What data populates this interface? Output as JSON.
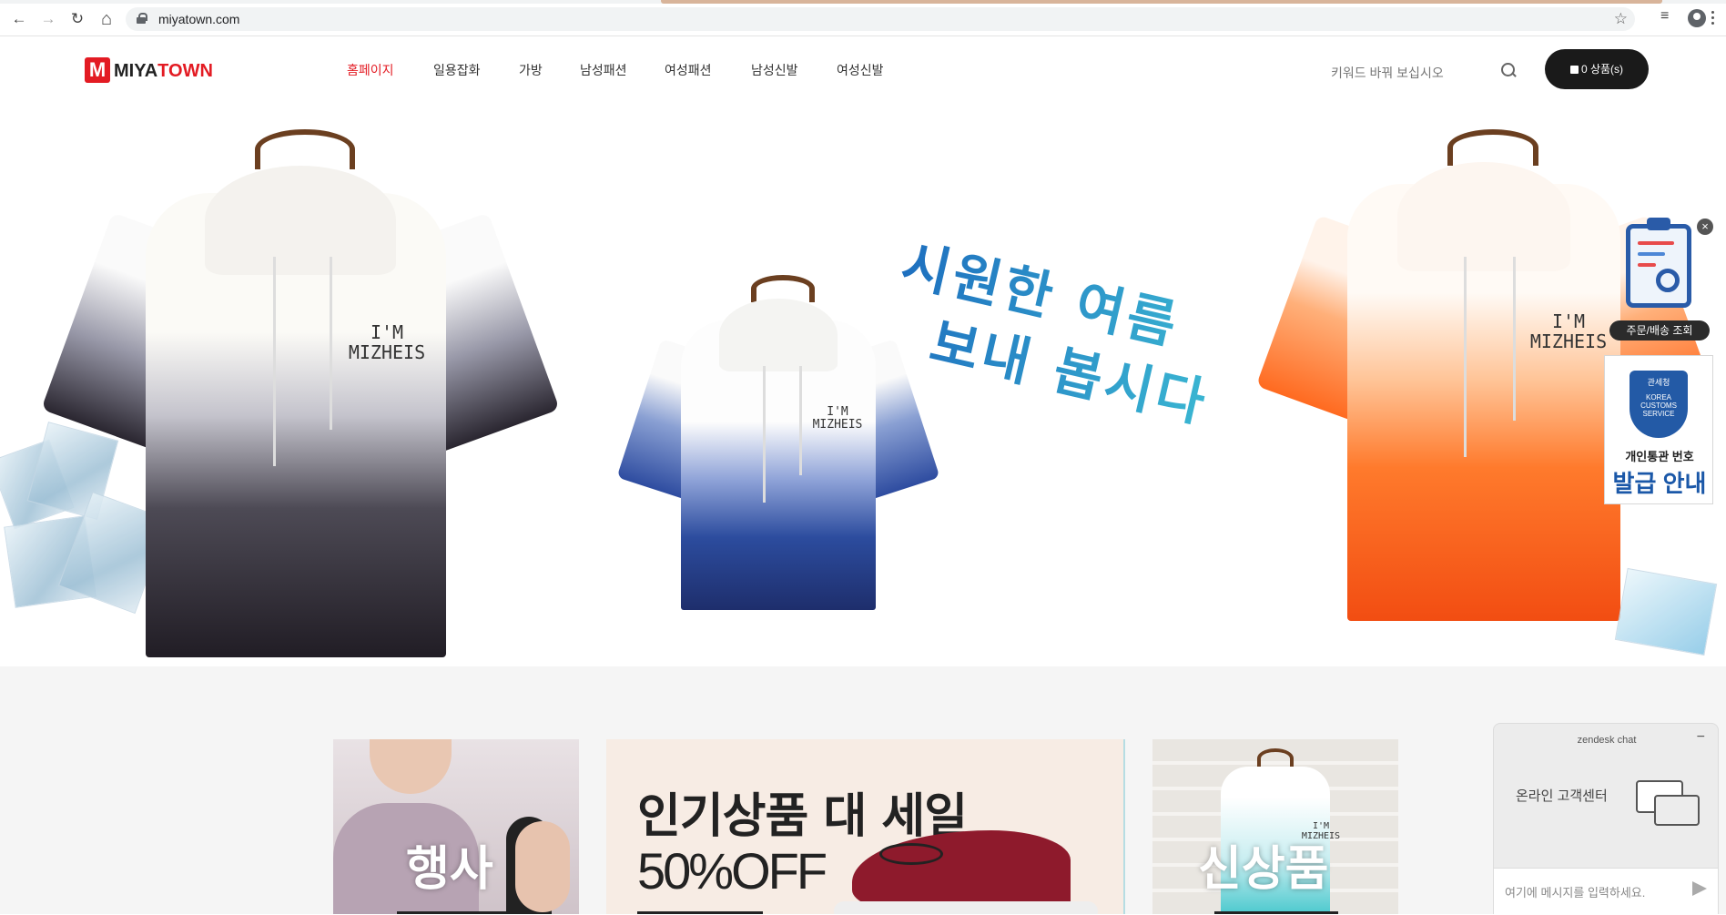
{
  "browser": {
    "url": "miyatown.com",
    "back_icon": "←",
    "forward_icon": "→",
    "reload_icon": "↻",
    "home_icon": "⌂",
    "star_icon": "☆",
    "playlist_icon": "≡"
  },
  "header": {
    "logo": {
      "mark": "M",
      "text_a": "MIYA",
      "text_b": "TOWN"
    },
    "menu": [
      "홈페이지",
      "일용잡화",
      "가방",
      "남성패션",
      "여성패션",
      "남성신발",
      "여성신발"
    ],
    "active_index": 0,
    "active_color": "#e31b23",
    "search_placeholder": "키워드 바꿔 보십시오",
    "cart_label": "0 상품(s)"
  },
  "hero": {
    "line1": "시원한 여름",
    "line2": "보내 봅시다",
    "shirt_print": "I'M\nMIZHEIS"
  },
  "side_widgets": {
    "close": "×",
    "order_lookup": "주문/배송 조회",
    "customs_badge_ko": "관세청",
    "customs_badge_en": "KOREA\nCUSTOMS\nSERVICE",
    "customs_line1": "개인통관 번호",
    "customs_line2": "발급 안내"
  },
  "promo": {
    "card1_title": "행사",
    "card2_line1": "인기상품 대 세일",
    "card2_line2": "50%OFF",
    "card3_title": "신상품",
    "card3_print": "I'M\nMIZHEIS"
  },
  "chat": {
    "title": "zendesk chat",
    "minimize": "−",
    "body": "온라인 고객센터",
    "input_placeholder": "여기에 메시지를 입력하세요."
  }
}
